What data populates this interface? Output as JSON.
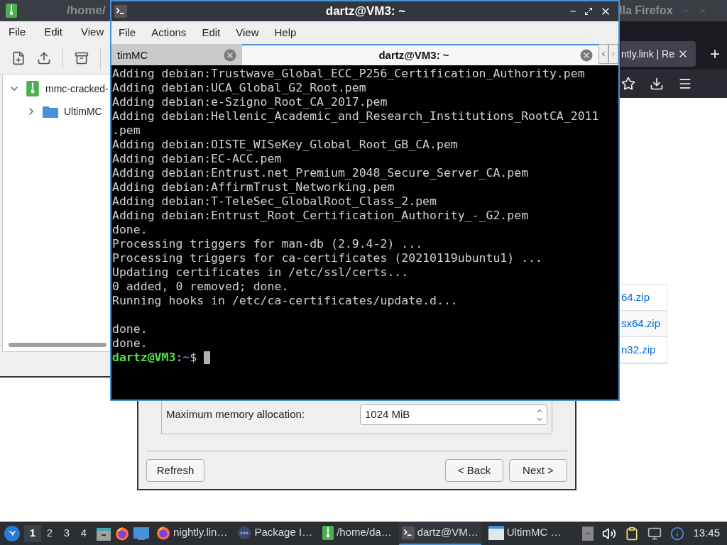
{
  "file_manager": {
    "title": "/home/",
    "menu": [
      "File",
      "Edit",
      "View"
    ],
    "tree": [
      {
        "label": "mmc-cracked-",
        "expanded": true,
        "children": [
          {
            "label": "UltimMC",
            "expanded": false
          }
        ]
      }
    ]
  },
  "browser": {
    "title": "lla Firefox",
    "tab": {
      "label": "ntly.link | Re"
    },
    "new_tab": "+",
    "files": [
      {
        "name": "64.zip"
      },
      {
        "name": "sx64.zip"
      },
      {
        "name": "n32.zip"
      }
    ]
  },
  "launcher_dialog": {
    "memory_label": "Maximum memory allocation:",
    "memory_value": "1024 MiB",
    "left_buttons": [
      "Refresh"
    ],
    "right_buttons": [
      "< Back",
      "Next >"
    ]
  },
  "terminal": {
    "title": "dartz@VM3: ~",
    "menu": [
      "File",
      "Actions",
      "Edit",
      "View",
      "Help"
    ],
    "tabs": [
      {
        "label": "timMC",
        "selected": false
      },
      {
        "label": "dartz@VM3: ~",
        "selected": true
      }
    ],
    "output_blocks": [
      [
        "Adding debian:Trustwave_Global_ECC_P256_Certification_Authority.pem",
        "Adding debian:UCA_Global_G2_Root.pem",
        "Adding debian:e-Szigno_Root_CA_2017.pem",
        "Adding debian:Hellenic_Academic_and_Research_Institutions_RootCA_2011",
        ".pem",
        "Adding debian:OISTE_WISeKey_Global_Root_GB_CA.pem",
        "Adding debian:EC-ACC.pem",
        "Adding debian:Entrust.net_Premium_2048_Secure_Server_CA.pem",
        "Adding debian:AffirmTrust_Networking.pem",
        "Adding debian:T-TeleSec_GlobalRoot_Class_2.pem",
        "Adding debian:Entrust_Root_Certification_Authority_-_G2.pem",
        "done.",
        "Processing triggers for man-db (2.9.4-2) ...",
        "Processing triggers for ca-certificates (20210119ubuntu1) ...",
        "Updating certificates in /etc/ssl/certs...",
        "0 added, 0 removed; done.",
        "Running hooks in /etc/ca-certificates/update.d..."
      ],
      [
        "done.",
        "done."
      ]
    ],
    "prompt": {
      "user": "dartz@VM3",
      "separator": ":",
      "path": "~",
      "symbol": "$"
    }
  },
  "taskbar": {
    "workspaces": [
      {
        "label": "1",
        "selected": true
      },
      {
        "label": "2",
        "selected": false
      },
      {
        "label": "3",
        "selected": false
      },
      {
        "label": "4",
        "selected": false
      }
    ],
    "tasks": [
      {
        "label": "nightly.lin…",
        "kind": "firefox",
        "selected": false
      },
      {
        "label": "Package I…",
        "kind": "package",
        "selected": false
      },
      {
        "label": "/home/da…",
        "kind": "archive",
        "selected": false
      },
      {
        "label": "dartz@VM…",
        "kind": "terminal",
        "selected": true
      },
      {
        "label": "UltimMC …",
        "kind": "window",
        "selected": false
      }
    ],
    "clock": "13:45"
  }
}
